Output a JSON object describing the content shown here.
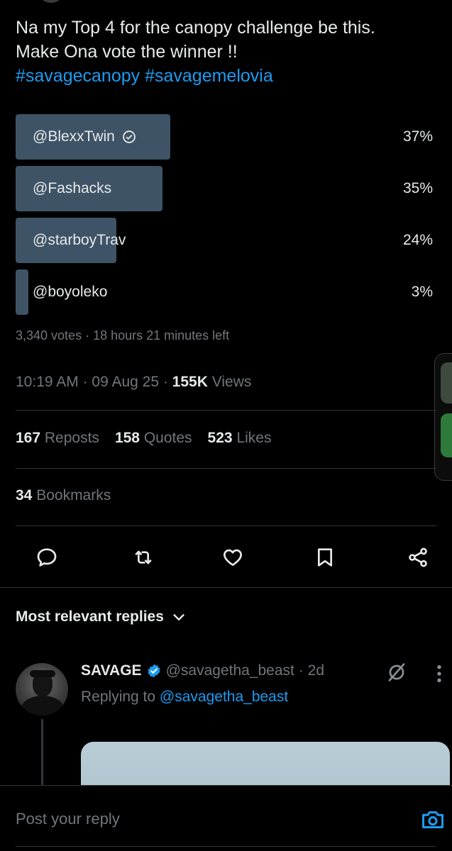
{
  "tweet": {
    "text_line1": "Na my Top 4 for the canopy challenge be this.",
    "text_line2": "Make Ona vote the winner !!",
    "hashtags": "#savagecanopy #savagemelovia"
  },
  "poll": {
    "options": [
      {
        "label": "@BlexxTwin",
        "percent_label": "37%",
        "percent": 37,
        "winner": true
      },
      {
        "label": "@Fashacks",
        "percent_label": "35%",
        "percent": 35,
        "winner": false
      },
      {
        "label": "@starboyTrav",
        "percent_label": "24%",
        "percent": 24,
        "winner": false
      },
      {
        "label": "@boyoleko",
        "percent_label": "3%",
        "percent": 3,
        "winner": false
      }
    ],
    "meta": "3,340 votes · 18 hours 21 minutes left"
  },
  "timestamp": {
    "time": "10:19 AM",
    "date": "09 Aug 25",
    "views_count": "155K",
    "views_label": "Views"
  },
  "stats": {
    "reposts_count": "167",
    "reposts_label": "Reposts",
    "quotes_count": "158",
    "quotes_label": "Quotes",
    "likes_count": "523",
    "likes_label": "Likes",
    "bookmarks_count": "34",
    "bookmarks_label": "Bookmarks"
  },
  "actions": [
    "reply-icon",
    "repost-icon",
    "like-icon",
    "bookmark-icon",
    "share-icon"
  ],
  "replies": {
    "header": "Most relevant replies",
    "items": [
      {
        "name": "SAVAGE",
        "handle": "@savagetha_beast",
        "age": "· 2d",
        "replying_prefix": "Replying to",
        "replying_to": "@savagetha_beast"
      }
    ]
  },
  "composer": {
    "placeholder": "Post your reply"
  },
  "colors": {
    "accent": "#1d9bf0",
    "poll_bar": "#3e5366",
    "muted": "#71767b",
    "text": "#e7e9ea",
    "background": "#000000"
  }
}
